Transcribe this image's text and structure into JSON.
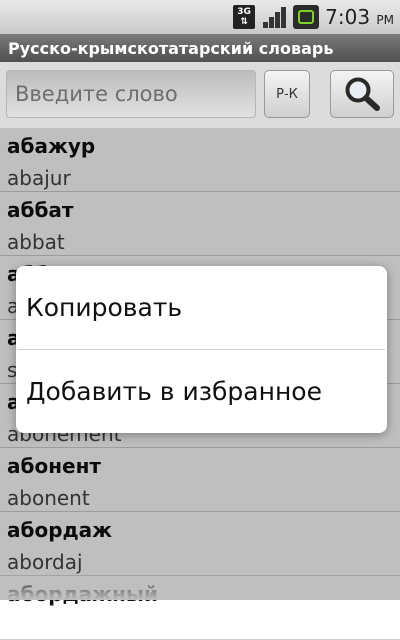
{
  "status_bar": {
    "network_type": "3G",
    "time": "7:03",
    "time_suffix": "PM",
    "icons": [
      "3g-data-icon",
      "signal-strength-icon",
      "battery-icon"
    ]
  },
  "app": {
    "title": "Русско-крымскотатарский словарь"
  },
  "search": {
    "placeholder": "Введите слово",
    "value": "",
    "direction_label": "Р-К",
    "search_icon": "magnifier-icon"
  },
  "list": [
    {
      "word": "абажур",
      "translation": "abajur"
    },
    {
      "word": "аббат",
      "translation": "abbat"
    },
    {
      "word": "абб…",
      "translation": "a…"
    },
    {
      "word": "а…",
      "translation": "s…"
    },
    {
      "word": "а…",
      "translation": "abonement"
    },
    {
      "word": "абонент",
      "translation": "abonent"
    },
    {
      "word": "абордаж",
      "translation": "abordaj"
    },
    {
      "word": "абордажный",
      "translation": ""
    }
  ],
  "context_menu": {
    "items": [
      {
        "label": "Копировать"
      },
      {
        "label": "Добавить в избранное"
      }
    ]
  },
  "colors": {
    "title_bar": "#5f5f5f",
    "search_area": "#dcdcdc",
    "battery_accent": "#7cd12b"
  }
}
